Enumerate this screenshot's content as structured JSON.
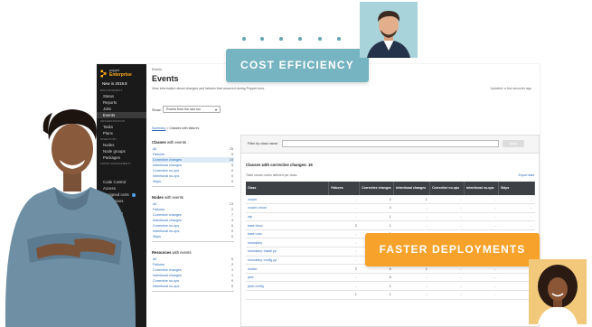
{
  "badges": {
    "cost_efficiency": "COST EFFICIENCY",
    "faster_deployments": "FASTER DEPLOYMENTS"
  },
  "colors": {
    "sidebar_bg": "#1a1a1a",
    "brand_accent": "#ffae1a",
    "link": "#2a6bb8",
    "cost_badge": "#77b4c1",
    "fast_badge": "#f7a22b",
    "table_header": "#3d4045"
  },
  "icons": {
    "brand": "puppet-logo-icon",
    "select": "chevron-down-icon"
  },
  "sidebar": {
    "brand_line1": "puppet",
    "brand_line2": "Enterprise",
    "new_label": "New in 2019.8",
    "sections": [
      {
        "title": "ENFORCEMENT",
        "items": [
          "Status",
          "Reports",
          "Jobs",
          "Events"
        ]
      },
      {
        "title": "ORCHESTRATION",
        "items": [
          "Tasks",
          "Plans"
        ]
      },
      {
        "title": "INVENTORY",
        "items": [
          "Nodes",
          "Node groups",
          "Packages"
        ]
      },
      {
        "title": "ADMIN MANAGEMENT",
        "items": [
          "",
          ""
        ]
      },
      {
        "title": "",
        "items": [
          "Code Control",
          "Access",
          "Unsigned certs",
          "Integrations",
          "Help",
          "My account",
          "Log out"
        ]
      }
    ],
    "unsigned_badge": "1",
    "footer_link": "License"
  },
  "main": {
    "breadcrumb": "Events",
    "title": "Events",
    "description": "View information about changes and failures that occurred during Puppet runs.",
    "updated": "Updated: a few seconds ago",
    "show_label": "Show:",
    "show_value": "Events from the last run",
    "summary_link": "Summary",
    "summary_separator": ">",
    "summary_current": "Classes with failures"
  },
  "filters": [
    {
      "title": "Classes",
      "title_suffix": "with events",
      "rows": [
        {
          "label": "All",
          "count": "25"
        },
        {
          "label": "Failures",
          "count": "5"
        },
        {
          "label": "Corrective changes",
          "count": "15"
        },
        {
          "label": "Intentional changes",
          "count": "5"
        },
        {
          "label": "Corrective no-ops",
          "count": "0"
        },
        {
          "label": "Intentional no-ops",
          "count": "0"
        },
        {
          "label": "Skips",
          "count": "0"
        }
      ]
    },
    {
      "title": "Nodes",
      "title_suffix": "with events",
      "rows": [
        {
          "label": "All",
          "count": "13"
        },
        {
          "label": "Failures",
          "count": "2"
        },
        {
          "label": "Corrective changes",
          "count": "7"
        },
        {
          "label": "Intentional changes",
          "count": "4"
        },
        {
          "label": "Corrective no-ops",
          "count": "0"
        },
        {
          "label": "Intentional no-ops",
          "count": "0"
        },
        {
          "label": "Skips",
          "count": "0"
        }
      ]
    },
    {
      "title": "Resources",
      "title_suffix": "with events",
      "rows": [
        {
          "label": "All",
          "count": "6"
        },
        {
          "label": "Failures",
          "count": "2"
        },
        {
          "label": "Corrective changes",
          "count": "1"
        },
        {
          "label": "Intentional changes",
          "count": "1"
        },
        {
          "label": "Corrective no-ops",
          "count": "0"
        },
        {
          "label": "Intentional no-ops",
          "count": "0"
        }
      ]
    }
  ],
  "panel": {
    "filter_label": "Filter by class name:",
    "filter_placeholder": "",
    "filter_button": "Apply",
    "heading": "Classes with corrective changes: 15",
    "subtext": "Table shows nodes affected per class.",
    "export": "Export data",
    "columns": [
      "Class",
      "Failures",
      "Corrective changes",
      "Intentional changes",
      "Corrective no-ops",
      "Intentional no-ops",
      "Skips"
    ],
    "rows": [
      [
        "zoochi",
        "-",
        "2",
        "1",
        "-",
        "-",
        "-"
      ],
      [
        "zoochi::shoot",
        "-",
        "4",
        "-",
        "-",
        "-",
        "-"
      ],
      [
        "ntp",
        "-",
        "1",
        "-",
        "-",
        "-",
        "-"
      ],
      [
        "base::linux",
        "2",
        "1",
        "-",
        "-",
        "-",
        "-"
      ],
      [
        "base::unix",
        "-",
        "1",
        "-",
        "-",
        "-",
        "-"
      ],
      [
        "shoodoley",
        "-",
        "1",
        "-",
        "-",
        "-",
        "-"
      ],
      [
        "shoodoley::install.pp",
        "-",
        "1",
        "-",
        "-",
        "-",
        "-"
      ],
      [
        "shoodoley::config.pp",
        "-",
        "1",
        "-",
        "-",
        "-",
        "-"
      ],
      [
        "docker",
        "2",
        "6",
        "1",
        "-",
        "-",
        "-"
      ],
      [
        "java",
        "-",
        "6",
        "-",
        "-",
        "-",
        "-"
      ],
      [
        "java::config",
        "-",
        "1",
        "-",
        "-",
        "-",
        "-"
      ],
      [
        "",
        "1",
        "1",
        "-",
        "-",
        "-",
        "-"
      ]
    ]
  }
}
